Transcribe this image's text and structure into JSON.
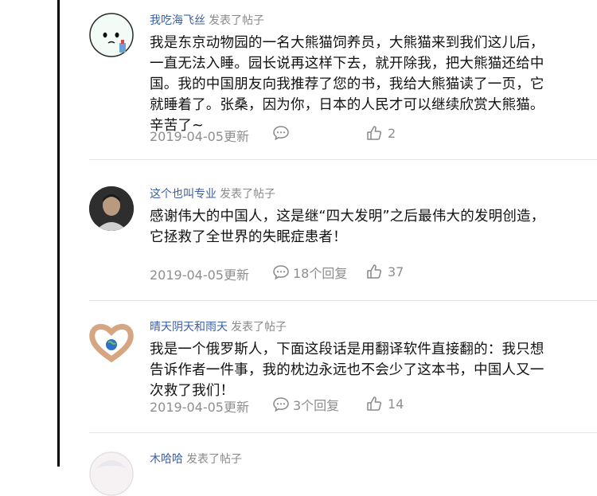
{
  "posts": [
    {
      "username": "我吃海飞丝",
      "action": "发表了帖子",
      "lines": [
        "我是东京动物园的一名大熊猫饲养员，大熊猫来到我们这儿后，",
        "一直无法入睡。园长说再这样下去，就开除我，把大熊猫还给中",
        "国。我的中国朋友向我推荐了您的书，我给大熊猫读了一页，它",
        "就睡着了。张桑，因为你，日本的人民才可以继续欣赏大熊猫。",
        "辛苦了~"
      ],
      "date": "2019-04-05更新",
      "replies": "",
      "likes": "2",
      "avatar": "cartoon-face"
    },
    {
      "username": "这个也叫专业",
      "action": "发表了帖子",
      "lines": [
        "感谢伟大的中国人，这是继“四大发明”之后最伟大的发明创造，",
        "它拯救了全世界的失眠症患者！"
      ],
      "date": "2019-04-05更新",
      "replies": "18个回复",
      "likes": "37",
      "avatar": "photo-person"
    },
    {
      "username": "晴天阴天和雨天",
      "action": "发表了帖子",
      "lines": [
        "我是一个俄罗斯人，下面这段话是用翻译软件直接翻的：我只想",
        "告诉作者一件事，我的枕边永远也不会少了这本书，中国人又一",
        "次救了我们！"
      ],
      "date": "2019-04-05更新",
      "replies": "3个回复",
      "likes": "14",
      "avatar": "heart-hands-globe"
    },
    {
      "username": "木哈哈",
      "action": "发表了帖子",
      "avatar": "anime-girl"
    }
  ]
}
